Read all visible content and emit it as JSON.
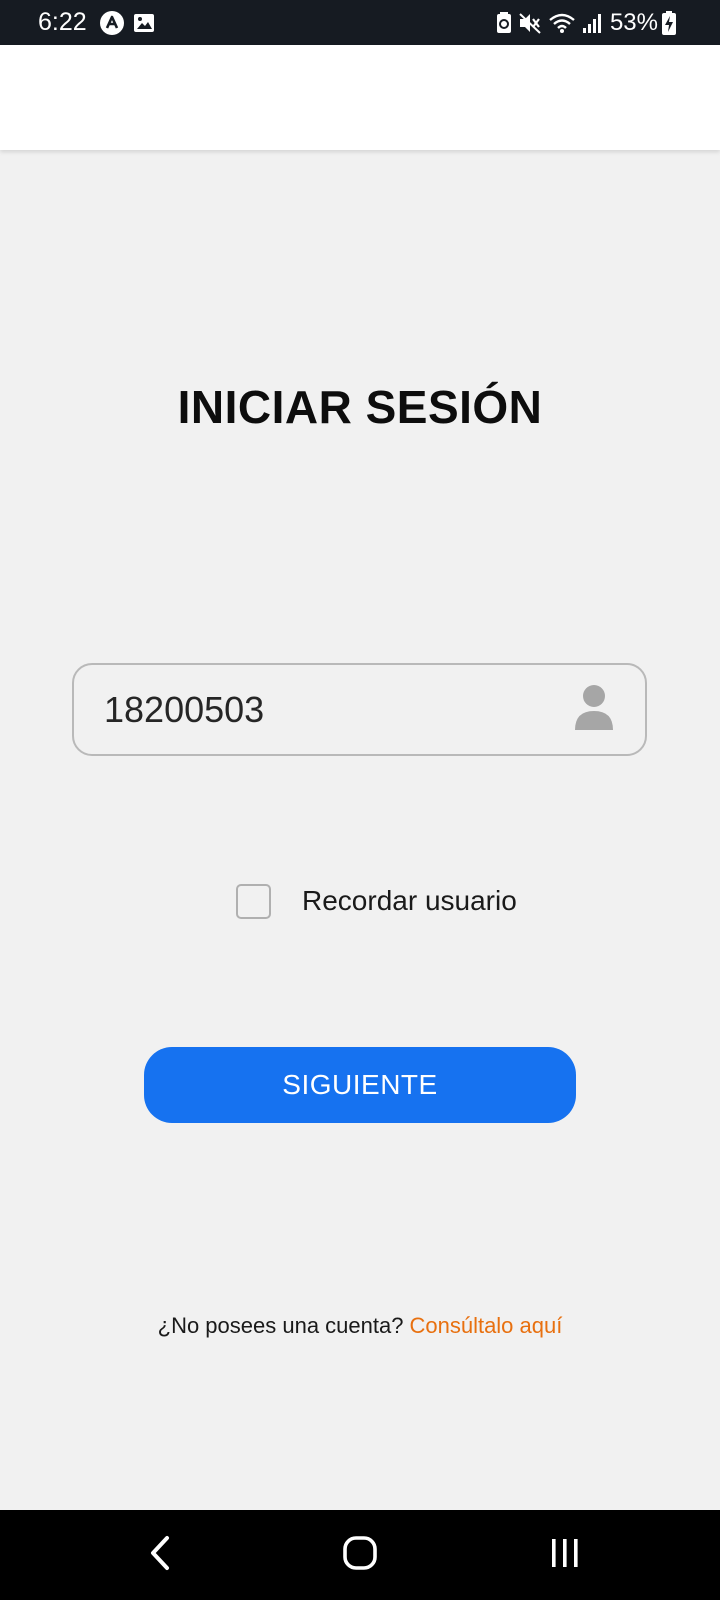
{
  "status_bar": {
    "time": "6:22",
    "battery_percent": "53%",
    "left_icons": [
      "notification-a-icon",
      "image-icon"
    ],
    "right_icons": [
      "battery-saver-icon",
      "mute-icon",
      "wifi-icon",
      "signal-icon",
      "battery-charging-icon"
    ]
  },
  "login": {
    "title": "INICIAR SESIÓN",
    "user_field_value": "18200503",
    "user_field_icon": "person-icon",
    "remember_label": "Recordar usuario",
    "remember_checked": false,
    "next_button_label": "SIGUIENTE",
    "signup_question": "¿No posees una cuenta?",
    "signup_link": "Consúltalo aquí"
  },
  "colors": {
    "primary_button": "#1672f0",
    "link": "#e8700f",
    "background": "#f1f1f1",
    "status_bar": "#161b22"
  },
  "nav_bar": {
    "icons": [
      "back-icon",
      "home-icon",
      "recents-icon"
    ]
  }
}
